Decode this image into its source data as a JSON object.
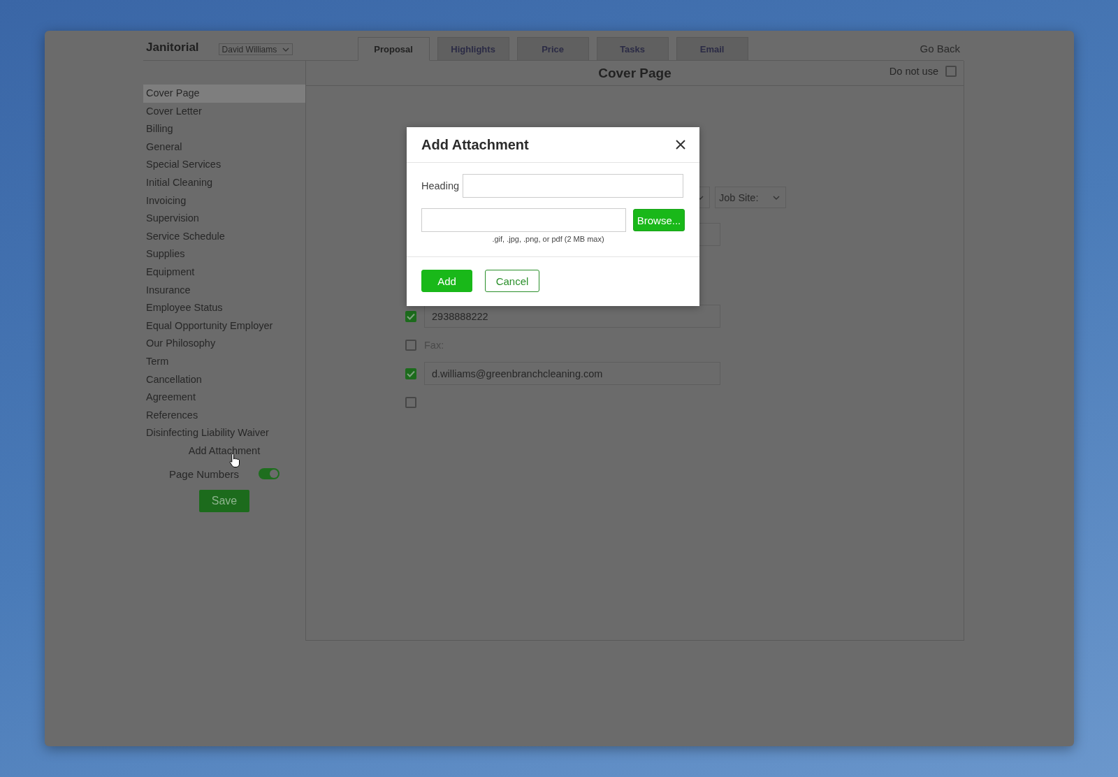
{
  "app": {
    "title": "Janitorial",
    "user_select": "David Williams",
    "go_back": "Go Back"
  },
  "tabs": [
    {
      "label": "Proposal",
      "selected": true
    },
    {
      "label": "Highlights",
      "selected": false
    },
    {
      "label": "Price",
      "selected": false
    },
    {
      "label": "Tasks",
      "selected": false
    },
    {
      "label": "Email",
      "selected": false
    }
  ],
  "sidebar": {
    "items": [
      {
        "label": "Cover Page",
        "selected": true
      },
      {
        "label": "Cover Letter",
        "selected": false
      },
      {
        "label": "Billing",
        "selected": false
      },
      {
        "label": "General",
        "selected": false
      },
      {
        "label": "Special Services",
        "selected": false
      },
      {
        "label": "Initial Cleaning",
        "selected": false
      },
      {
        "label": "Invoicing",
        "selected": false
      },
      {
        "label": "Supervision",
        "selected": false
      },
      {
        "label": "Service Schedule",
        "selected": false
      },
      {
        "label": "Supplies",
        "selected": false
      },
      {
        "label": "Equipment",
        "selected": false
      },
      {
        "label": "Insurance",
        "selected": false
      },
      {
        "label": "Employee Status",
        "selected": false
      },
      {
        "label": "Equal Opportunity Employer",
        "selected": false
      },
      {
        "label": "Our Philosophy",
        "selected": false
      },
      {
        "label": "Term",
        "selected": false
      },
      {
        "label": "Cancellation",
        "selected": false
      },
      {
        "label": "Agreement",
        "selected": false
      },
      {
        "label": "References",
        "selected": false
      },
      {
        "label": "Disinfecting Liability Waiver",
        "selected": false
      }
    ],
    "add_attachment": "Add Attachment",
    "page_numbers": {
      "label": "Page Numbers",
      "on": true
    },
    "save": "Save"
  },
  "panel": {
    "title": "Cover Page",
    "do_not_use": {
      "label": "Do not use",
      "checked": false
    },
    "job_site_select": "Job Site:",
    "contact_rows": [
      {
        "kind": "field",
        "checked": true,
        "value": "2938888222"
      },
      {
        "kind": "label",
        "checked": false,
        "text": "Fax:"
      },
      {
        "kind": "field",
        "checked": true,
        "value": "d.williams@greenbranchcleaning.com"
      },
      {
        "kind": "empty",
        "checked": false
      }
    ]
  },
  "dialog": {
    "title": "Add Attachment",
    "heading_label": "Heading",
    "browse": "Browse...",
    "hint": ".gif, .jpg, .png, or pdf (2 MB max)",
    "buttons": [
      {
        "label": "Add",
        "kind": "primary"
      },
      {
        "label": "Cancel",
        "kind": "secondary"
      }
    ]
  }
}
